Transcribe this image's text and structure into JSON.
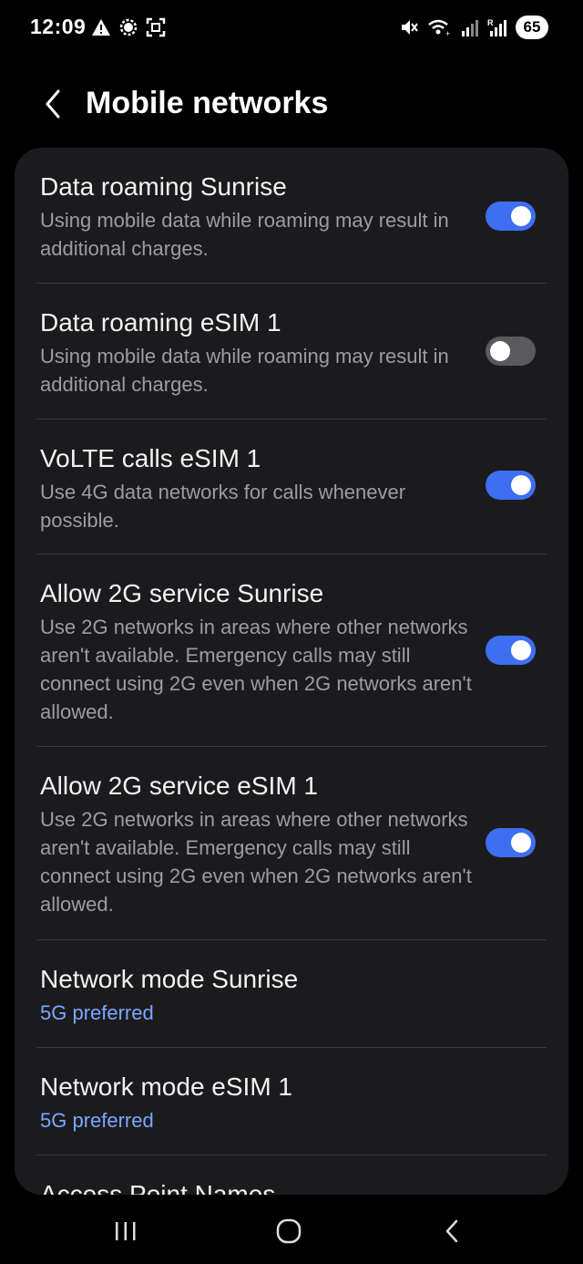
{
  "status_bar": {
    "time": "12:09",
    "battery": "65",
    "left_icons": [
      "warning-icon",
      "signal-app-icon",
      "screenshot-icon"
    ],
    "right_icons": [
      "mute-icon",
      "wifi-calling-icon",
      "signal-bars-icon",
      "roaming-signal-icon"
    ]
  },
  "header": {
    "title": "Mobile networks"
  },
  "settings": [
    {
      "title": "Data roaming Sunrise",
      "desc": "Using mobile data while roaming may result in additional charges.",
      "toggle": true
    },
    {
      "title": "Data roaming eSIM 1",
      "desc": "Using mobile data while roaming may result in additional charges.",
      "toggle": false
    },
    {
      "title": "VoLTE calls eSIM 1",
      "desc": "Use 4G data networks for calls whenever possible.",
      "toggle": true
    },
    {
      "title": "Allow 2G service Sunrise",
      "desc": "Use 2G networks in areas where other networks aren't available. Emergency calls may still connect using 2G even when 2G networks aren't allowed.",
      "toggle": true
    },
    {
      "title": "Allow 2G service eSIM 1",
      "desc": "Use 2G networks in areas where other networks aren't available. Emergency calls may still connect using 2G even when 2G networks aren't allowed.",
      "toggle": true
    },
    {
      "title": "Network mode Sunrise",
      "value": "5G preferred"
    },
    {
      "title": "Network mode eSIM 1",
      "value": "5G preferred"
    },
    {
      "title": "Access Point Names"
    }
  ],
  "colors": {
    "accent": "#3e6ff2",
    "link": "#7aa7ff",
    "card_bg": "#1b1b1e"
  }
}
